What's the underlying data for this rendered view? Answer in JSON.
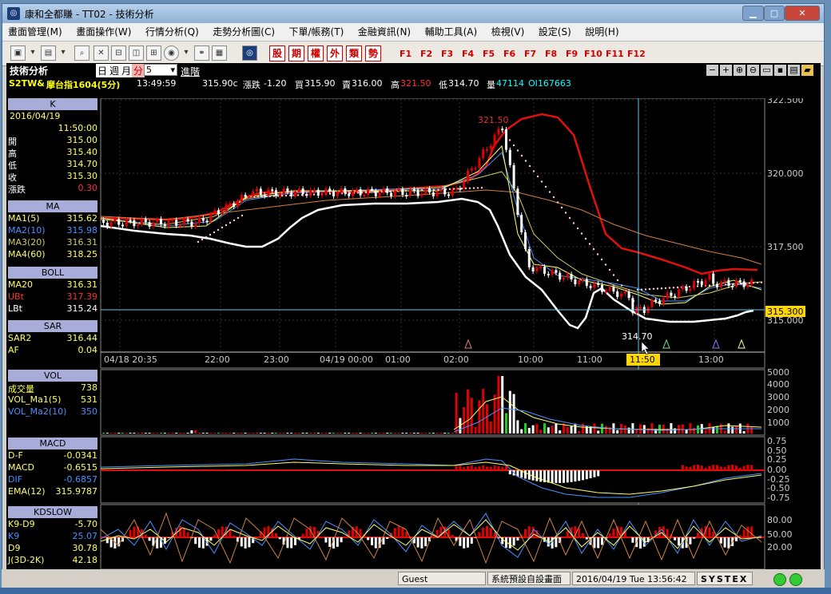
{
  "window": {
    "title": "康和全都賺 - TT02 - 技術分析",
    "min_label": "▁",
    "max_label": "▢",
    "close_label": "✕"
  },
  "menu": [
    "畫面管理(M)",
    "畫面操作(W)",
    "行情分析(Q)",
    "走勢分析圖(C)",
    "下單/帳務(T)",
    "金融資訊(N)",
    "輔助工具(A)",
    "檢視(V)",
    "設定(S)",
    "說明(H)"
  ],
  "toolbar": {
    "red_buttons": [
      "股",
      "期",
      "權",
      "外",
      "類",
      "勢"
    ],
    "fkeys": [
      "F1",
      "F2",
      "F3",
      "F4",
      "F5",
      "F6",
      "F7",
      "F8",
      "F9",
      "F10",
      "F11",
      "F12"
    ]
  },
  "header": {
    "title": "技術分析",
    "period_day": "日",
    "period_week": "週",
    "period_month": "月",
    "period_minute": "分",
    "period_value": "5",
    "advanced": "進階"
  },
  "quote": {
    "symbol": "S2TW&",
    "name": "摩台指1604(5分)",
    "time": "13:49:59",
    "price": "315.90c",
    "change_label": "漲跌",
    "change": "-1.20",
    "bid_label": "買",
    "bid": "315.90",
    "ask_label": "賣",
    "ask": "316.00",
    "high_label": "高",
    "high": "321.50",
    "low_label": "低",
    "low": "314.70",
    "vol_label": "量",
    "vol": "47114",
    "oi": "OI167663"
  },
  "left": {
    "k": {
      "head": "K",
      "date": "2016/04/19",
      "time": "11:50:00",
      "rows": [
        {
          "label": "開",
          "value": "315.00"
        },
        {
          "label": "高",
          "value": "315.40"
        },
        {
          "label": "低",
          "value": "314.70"
        },
        {
          "label": "收",
          "value": "315.30"
        },
        {
          "label": "漲跌",
          "value": "0.30"
        }
      ]
    },
    "ma": {
      "head": "MA",
      "rows": [
        {
          "label": "MA1(5)",
          "value": "315.62"
        },
        {
          "label": "MA2(10)",
          "value": "315.98"
        },
        {
          "label": "MA3(20)",
          "value": "316.31"
        },
        {
          "label": "MA4(60)",
          "value": "318.25"
        }
      ]
    },
    "boll": {
      "head": "BOLL",
      "rows": [
        {
          "label": "MA20",
          "value": "316.31"
        },
        {
          "label": "UBt",
          "value": "317.39"
        },
        {
          "label": "LBt",
          "value": "315.24"
        }
      ]
    },
    "sar": {
      "head": "SAR",
      "rows": [
        {
          "label": "SAR2",
          "value": "316.44"
        },
        {
          "label": "AF",
          "value": "0.04"
        }
      ]
    },
    "vol": {
      "head": "VOL",
      "rows": [
        {
          "label": "成交量",
          "value": "738"
        },
        {
          "label": "VOL_Ma1(5)",
          "value": "531"
        },
        {
          "label": "VOL_Ma2(10)",
          "value": "350"
        }
      ]
    },
    "macd": {
      "head": "MACD",
      "rows": [
        {
          "label": "D-F",
          "value": "-0.0341"
        },
        {
          "label": "MACD",
          "value": "-0.6515"
        },
        {
          "label": "DIF",
          "value": "-0.6857"
        },
        {
          "label": "EMA(12)",
          "value": "315.9787"
        }
      ]
    },
    "kd": {
      "head": "KDSLOW",
      "rows": [
        {
          "label": "K9-D9",
          "value": "-5.70"
        },
        {
          "label": "K9",
          "value": "25.07"
        },
        {
          "label": "D9",
          "value": "30.78"
        },
        {
          "label": "J(3D-2K)",
          "value": "42.18"
        }
      ]
    }
  },
  "chart": {
    "price_axis": [
      "322.500",
      "320.000",
      "317.500",
      "315.000"
    ],
    "time_axis": [
      "04/18 20:35",
      "22:00",
      "23:00",
      "04/19 00:00",
      "01:00",
      "02:00",
      "10:00",
      "11:00",
      "11:50",
      "13:00"
    ],
    "high_label": "321.50",
    "low_label": "314.70",
    "last_price": "315.300",
    "vol_axis": [
      "5000",
      "4000",
      "3000",
      "2000",
      "1000"
    ],
    "macd_axis": [
      "0.75",
      "0.50",
      "0.25",
      "0.00",
      "-0.25",
      "-0.50",
      "-0.75"
    ],
    "kd_axis": [
      "80.00",
      "50.00",
      "20.00"
    ]
  },
  "status": {
    "user": "Guest",
    "layout": "系統預設自設畫面",
    "datetime": "2016/04/19 Tue 13:56:42",
    "brand": "SYSTEX"
  },
  "colors": {
    "up": "#e00000",
    "down": "#ffffff",
    "ma5": "#ffff66",
    "ma10": "#4a90ff",
    "ma20": "#cccc66",
    "ma60": "#d08040",
    "boll_upper": "#e01010",
    "boll_lower": "#ffffff"
  }
}
